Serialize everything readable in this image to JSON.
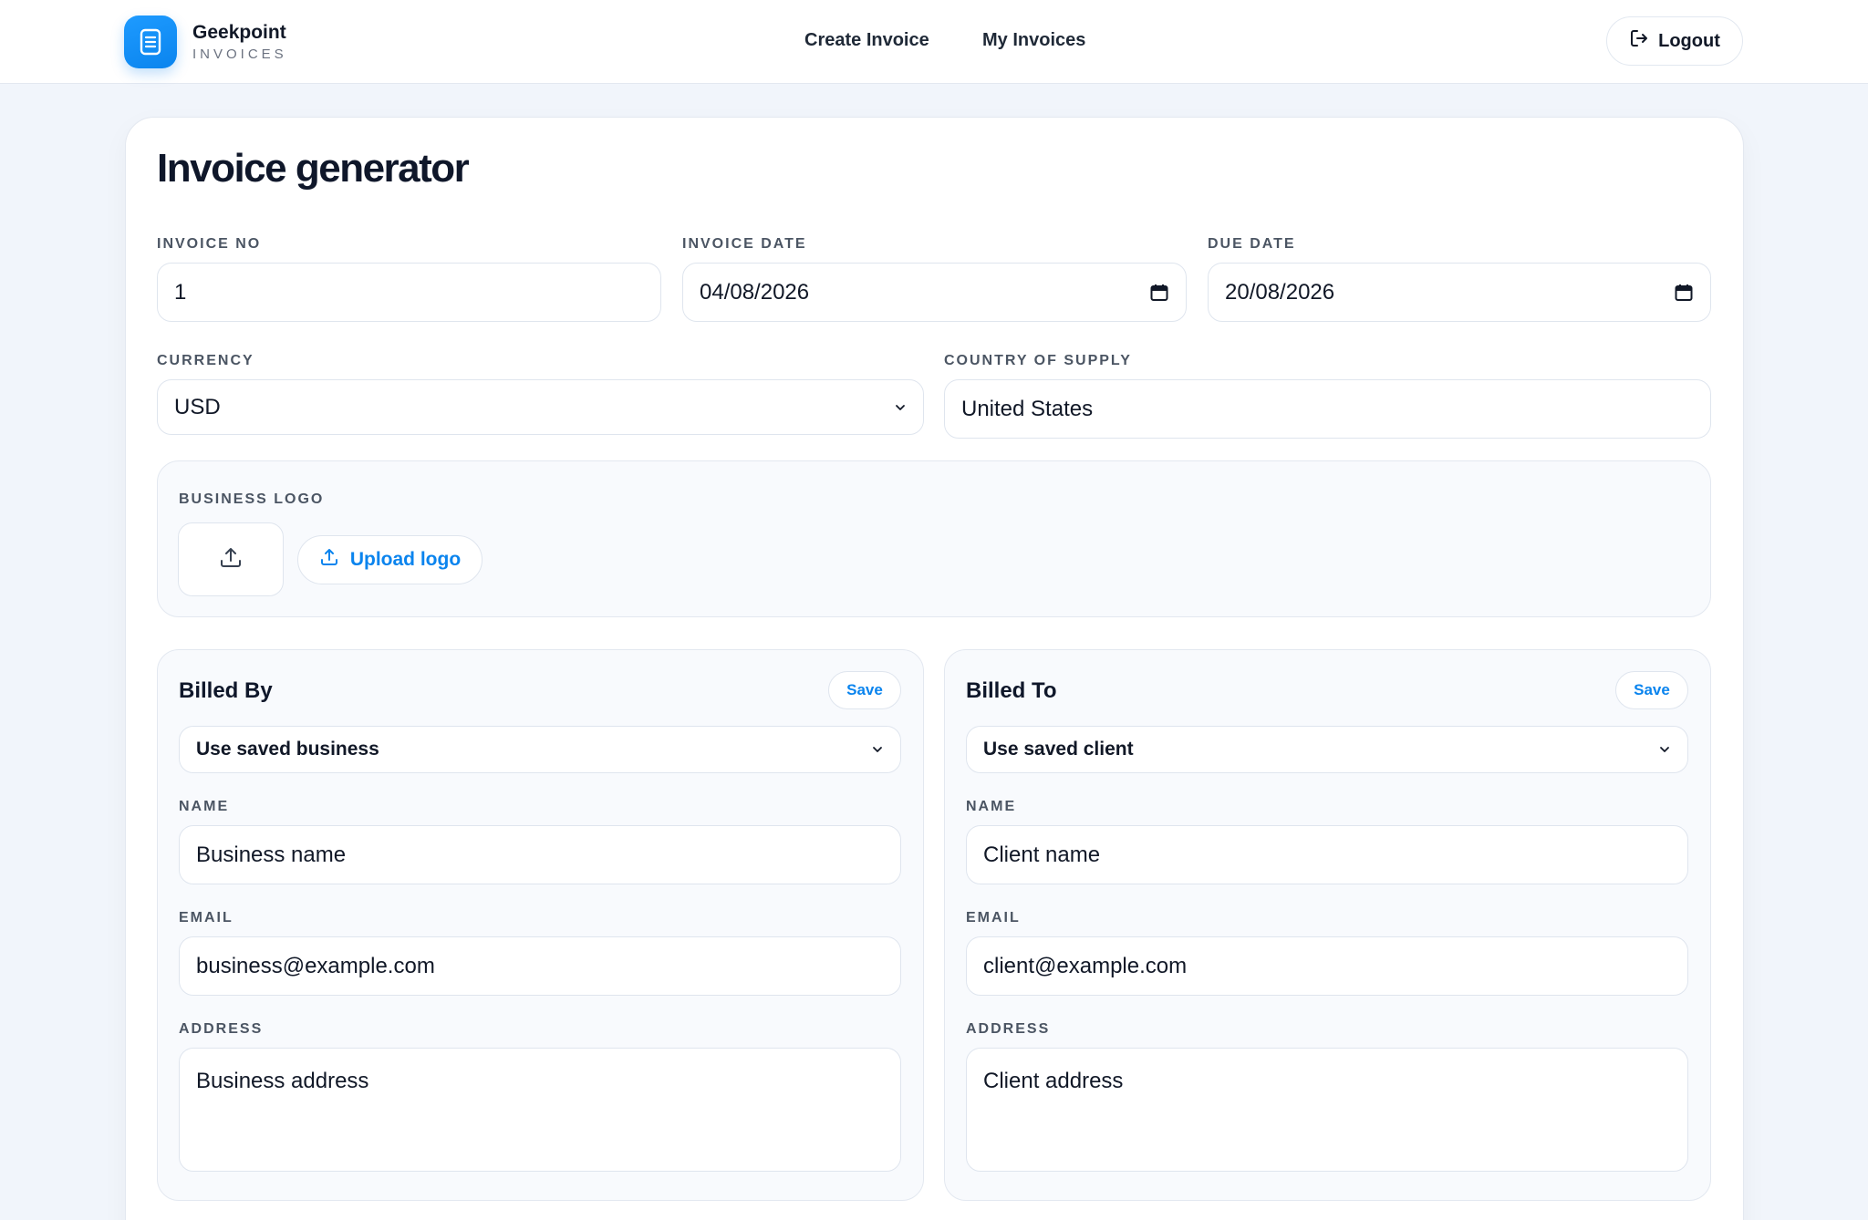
{
  "brand": {
    "name": "Geekpoint",
    "subtitle": "INVOICES"
  },
  "nav": {
    "create_invoice": "Create Invoice",
    "my_invoices": "My Invoices",
    "logout": "Logout"
  },
  "page": {
    "title": "Invoice generator"
  },
  "invoice": {
    "no_label": "INVOICE NO",
    "no_value": "1",
    "date_label": "INVOICE DATE",
    "date_value": "04/08/2026",
    "due_label": "DUE DATE",
    "due_value": "20/08/2026",
    "currency_label": "CURRENCY",
    "currency_value": "USD",
    "country_label": "COUNTRY OF SUPPLY",
    "country_value": "United States"
  },
  "logo": {
    "label": "BUSINESS LOGO",
    "upload_label": "Upload logo"
  },
  "billed_by": {
    "title": "Billed By",
    "save": "Save",
    "saved_select": "Use saved business",
    "name_label": "NAME",
    "name_placeholder": "Business name",
    "email_label": "EMAIL",
    "email_placeholder": "business@example.com",
    "address_label": "ADDRESS",
    "address_placeholder": "Business address"
  },
  "billed_to": {
    "title": "Billed To",
    "save": "Save",
    "saved_select": "Use saved client",
    "name_label": "NAME",
    "name_placeholder": "Client name",
    "email_label": "EMAIL",
    "email_placeholder": "client@example.com",
    "address_label": "ADDRESS",
    "address_placeholder": "Client address"
  },
  "icons": {
    "brand": "document-icon",
    "logout": "logout-icon",
    "calendar": "calendar-icon",
    "chevron": "chevron-down-icon",
    "upload": "upload-icon"
  },
  "colors": {
    "accent": "#0a84ee",
    "background": "#f1f5fb",
    "text": "#0f172a"
  }
}
